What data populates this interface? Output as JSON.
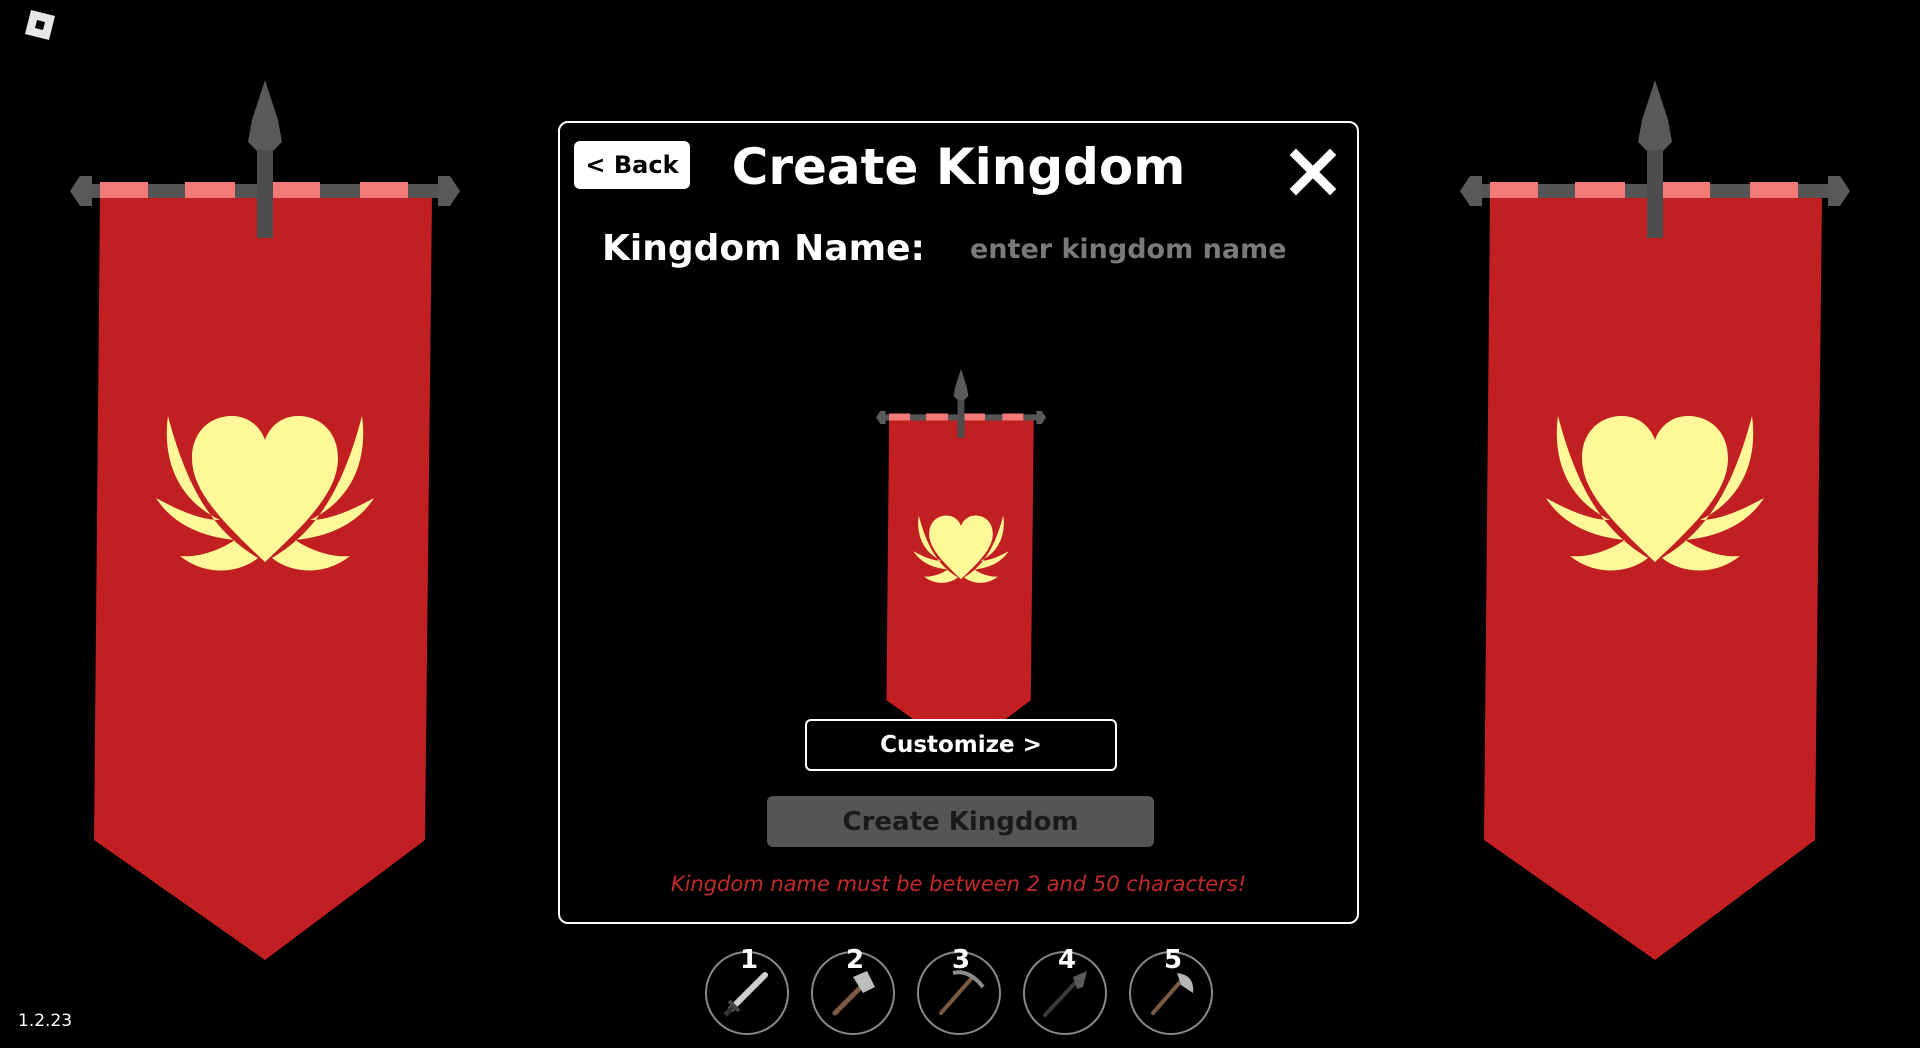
{
  "version": "1.2.23",
  "dialog": {
    "back_label": "< Back",
    "title": "Create Kingdom",
    "name_label": "Kingdom Name:",
    "name_placeholder": "enter kingdom name",
    "name_value": "",
    "customize_label": "Customize >",
    "create_label": "Create Kingdom",
    "error_message": "Kingdom name must be between 2 and 50 characters!"
  },
  "banner": {
    "cloth_color": "#c11f21",
    "tab_color": "#f47a78",
    "emblem_color": "#fff898",
    "pole_color": "#555555",
    "emblem": "winged-heart-icon"
  },
  "hotbar": [
    {
      "number": "1",
      "tool": "sword-icon"
    },
    {
      "number": "2",
      "tool": "hammer-icon"
    },
    {
      "number": "3",
      "tool": "pickaxe-icon"
    },
    {
      "number": "4",
      "tool": "shovel-icon"
    },
    {
      "number": "5",
      "tool": "axe-icon"
    }
  ]
}
